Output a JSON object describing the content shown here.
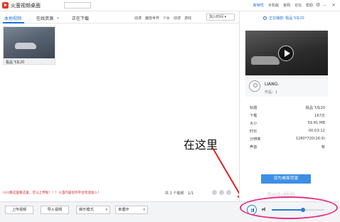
{
  "app": {
    "title": "火萤视频桌面"
  },
  "top_links": [
    "新特性",
    "手机版",
    "官网",
    "论坛",
    "帮助"
  ],
  "tabs": {
    "local": "本地视频",
    "online": "在线资源",
    "downloading": "正在下载"
  },
  "categories": [
    "动漫",
    "魔兽世界",
    "少女",
    "动漫",
    "游戏"
  ],
  "sort_label": "加入时间",
  "video": {
    "name": "极品飞车20"
  },
  "notice": "川川看这里看这里，可以上传啦！！！火萤内容创作平台欢迎加入！",
  "pager": {
    "count_text": "共 1 个视频",
    "page_text": "1/1"
  },
  "bottom": {
    "upload": "上传视频",
    "import": "导入视频",
    "mode": "娱乐模式",
    "loop": "单循环"
  },
  "right": {
    "now_playing": "正在播放: 极品飞车20",
    "author": "LIANG.",
    "works": "作品：1",
    "info": [
      {
        "k": "标题",
        "v": "极品飞车20"
      },
      {
        "k": "下载",
        "v": "167次"
      },
      {
        "k": "大小",
        "v": "59.81 MB"
      },
      {
        "k": "时长",
        "v": "00:03:12"
      },
      {
        "k": "分辨率",
        "v": "1280*720(16:9)"
      },
      {
        "k": "声音",
        "v": "有"
      }
    ],
    "set_bg": "设为桌面背景"
  },
  "player": {
    "volume": 0.6
  },
  "annotation": "在这里",
  "watermark": "Baidu经验"
}
